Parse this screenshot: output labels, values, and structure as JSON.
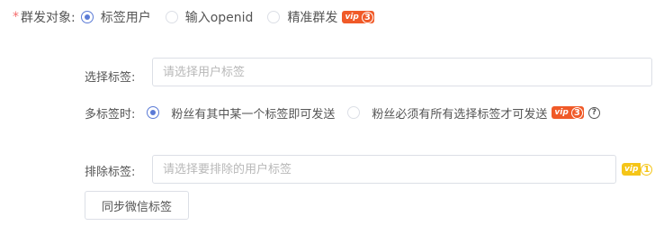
{
  "target": {
    "required_mark": "*",
    "label": "群发对象:",
    "options": [
      {
        "label": "标签用户",
        "checked": true
      },
      {
        "label": "输入openid",
        "checked": false
      },
      {
        "label": "精准群发",
        "checked": false
      }
    ],
    "precise_vip": {
      "text": "vip",
      "level": "3"
    }
  },
  "select_tags": {
    "label": "选择标签:",
    "placeholder": "请选择用户标签"
  },
  "multi_tag": {
    "label": "多标签时:",
    "options": [
      {
        "label": "粉丝有其中某一个标签即可发送",
        "checked": true
      },
      {
        "label": "粉丝必须有所有选择标签才可发送",
        "checked": false
      }
    ],
    "vip": {
      "text": "vip",
      "level": "3"
    },
    "help_icon": "question-circle-icon",
    "help_glyph": "?"
  },
  "exclude_tags": {
    "label": "排除标签:",
    "placeholder": "请选择要排除的用户标签",
    "vip": {
      "text": "vip",
      "level": "1"
    }
  },
  "sync_button": {
    "label": "同步微信标签"
  },
  "colors": {
    "accent": "#5b7bd6",
    "required": "#f56c6c",
    "vip_red": "#f05a28",
    "vip_yellow": "#f5c518",
    "border": "#dcdfe6",
    "placeholder": "#b8b8b8"
  }
}
